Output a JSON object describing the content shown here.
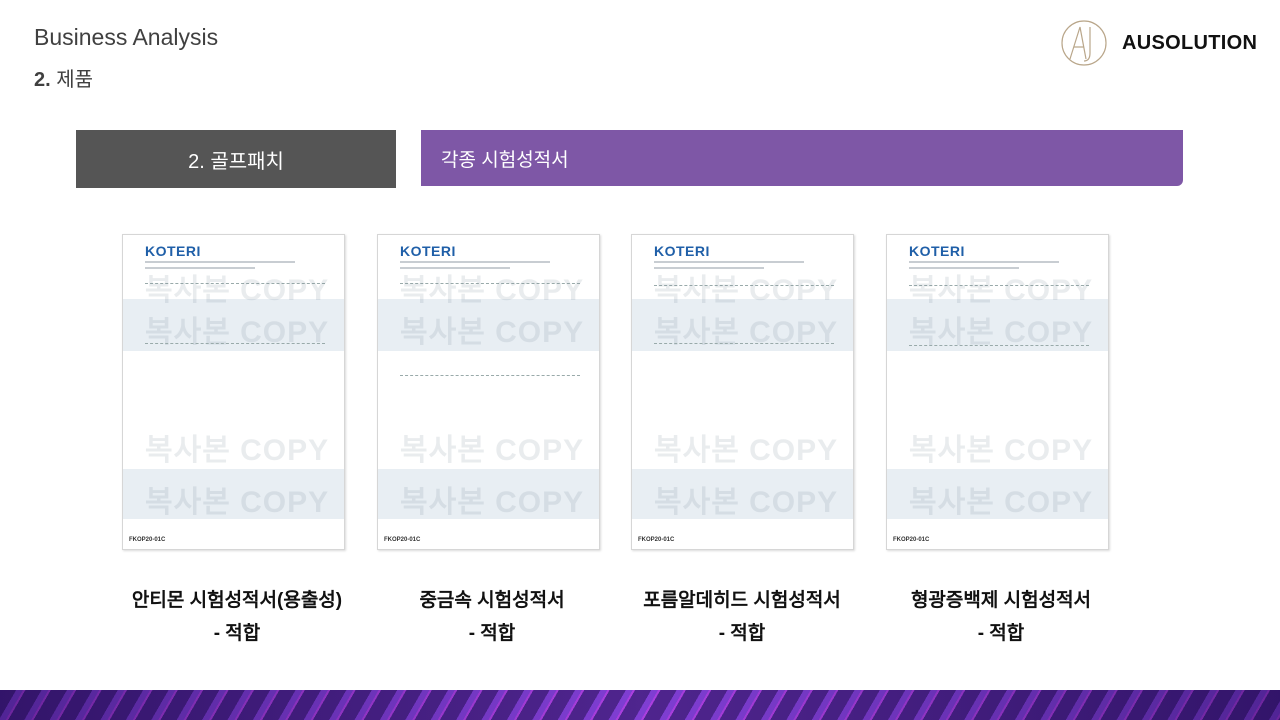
{
  "header": {
    "title": "Business Analysis",
    "section_num": "2.",
    "section_label": "제품"
  },
  "logo": {
    "text": "AUSOLUTION"
  },
  "category_box": {
    "label": "2. 골프패치"
  },
  "title_box": {
    "label": "각종 시험성적서"
  },
  "documents": [
    {
      "logo": "KOTERI",
      "watermark": "복사본 COPY",
      "code": "FKOP20-01C",
      "caption": "안티몬 시험성적서(용출성)",
      "result": "- 적합"
    },
    {
      "logo": "KOTERI",
      "watermark": "복사본 COPY",
      "code": "FKOP20-01C",
      "caption": "중금속 시험성적서",
      "result": "- 적합"
    },
    {
      "logo": "KOTERI",
      "watermark": "복사본 COPY",
      "code": "FKOP20-01C",
      "caption": "포름알데히드 시험성적서",
      "result": "- 적합"
    },
    {
      "logo": "KOTERI",
      "watermark": "복사본 COPY",
      "code": "FKOP20-01C",
      "caption": "형광증백제 시험성적서",
      "result": "- 적합"
    }
  ],
  "colors": {
    "dark_box": "#555555",
    "purple_box": "#7e57a6",
    "doc_logo": "#1f5fa8"
  }
}
